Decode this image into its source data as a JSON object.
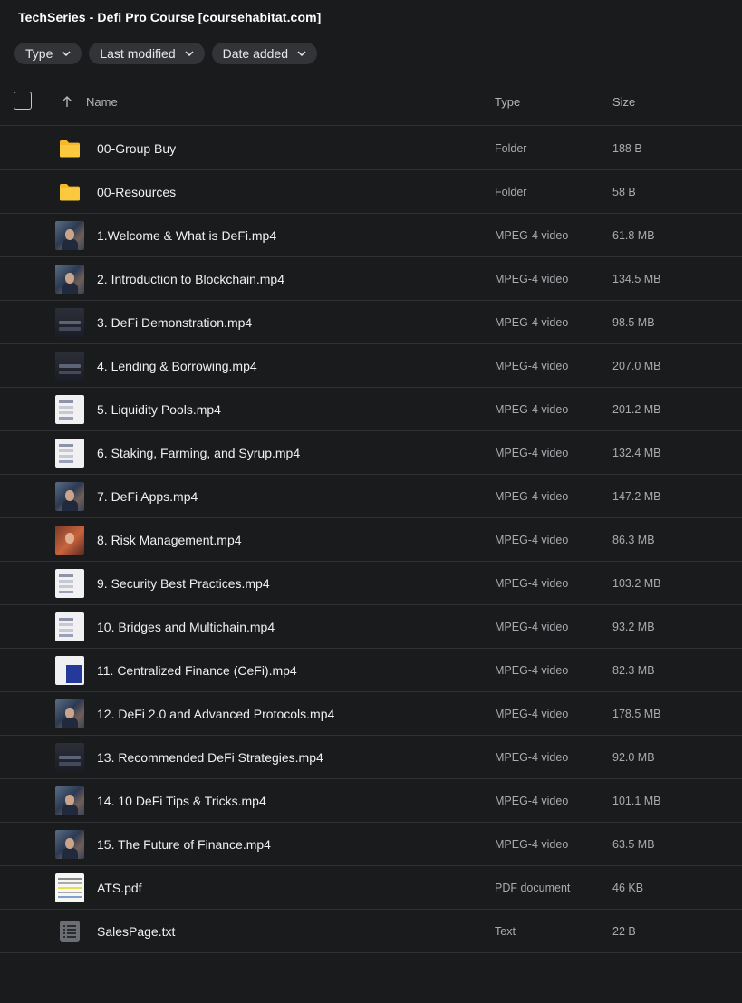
{
  "title": "TechSeries - Defi Pro Course [coursehabitat.com]",
  "filters": [
    "Type",
    "Last modified",
    "Date added"
  ],
  "columns": {
    "name": "Name",
    "type": "Type",
    "size": "Size"
  },
  "items": [
    {
      "name": "00-Group Buy",
      "type": "Folder",
      "size": "188 B",
      "icon": "folder-icon"
    },
    {
      "name": "00-Resources",
      "type": "Folder",
      "size": "58 B",
      "icon": "folder-icon"
    },
    {
      "name": "1.Welcome & What is DeFi.mp4",
      "type": "MPEG-4 video",
      "size": "61.8 MB",
      "icon": "person"
    },
    {
      "name": "2. Introduction to Blockchain.mp4",
      "type": "MPEG-4 video",
      "size": "134.5 MB",
      "icon": "person"
    },
    {
      "name": "3. DeFi Demonstration.mp4",
      "type": "MPEG-4 video",
      "size": "98.5 MB",
      "icon": "dark"
    },
    {
      "name": "4. Lending & Borrowing.mp4",
      "type": "MPEG-4 video",
      "size": "207.0 MB",
      "icon": "dark"
    },
    {
      "name": "5. Liquidity Pools.mp4",
      "type": "MPEG-4 video",
      "size": "201.2 MB",
      "icon": "light"
    },
    {
      "name": "6. Staking, Farming, and Syrup.mp4",
      "type": "MPEG-4 video",
      "size": "132.4 MB",
      "icon": "light"
    },
    {
      "name": "7. DeFi Apps.mp4",
      "type": "MPEG-4 video",
      "size": "147.2 MB",
      "icon": "person"
    },
    {
      "name": "8. Risk Management.mp4",
      "type": "MPEG-4 video",
      "size": "86.3 MB",
      "icon": "red"
    },
    {
      "name": "9. Security Best Practices.mp4",
      "type": "MPEG-4 video",
      "size": "103.2 MB",
      "icon": "light"
    },
    {
      "name": "10. Bridges and Multichain.mp4",
      "type": "MPEG-4 video",
      "size": "93.2 MB",
      "icon": "light"
    },
    {
      "name": "11. Centralized Finance (CeFi).mp4",
      "type": "MPEG-4 video",
      "size": "82.3 MB",
      "icon": "blue"
    },
    {
      "name": "12. DeFi 2.0 and Advanced Protocols.mp4",
      "type": "MPEG-4 video",
      "size": "178.5 MB",
      "icon": "person"
    },
    {
      "name": "13. Recommended DeFi Strategies.mp4",
      "type": "MPEG-4 video",
      "size": "92.0 MB",
      "icon": "dark"
    },
    {
      "name": "14. 10 DeFi Tips & Tricks.mp4",
      "type": "MPEG-4 video",
      "size": "101.1 MB",
      "icon": "person"
    },
    {
      "name": "15. The Future of Finance.mp4",
      "type": "MPEG-4 video",
      "size": "63.5 MB",
      "icon": "person"
    },
    {
      "name": "ATS.pdf",
      "type": "PDF document",
      "size": "46 KB",
      "icon": "pdf"
    },
    {
      "name": "SalesPage.txt",
      "type": "Text",
      "size": "22 B",
      "icon": "text-file-icon"
    }
  ],
  "colors": {
    "background": "#1a1b1d",
    "chip": "#323438",
    "folder": "#f7b92b",
    "divider": "#2e3033"
  }
}
